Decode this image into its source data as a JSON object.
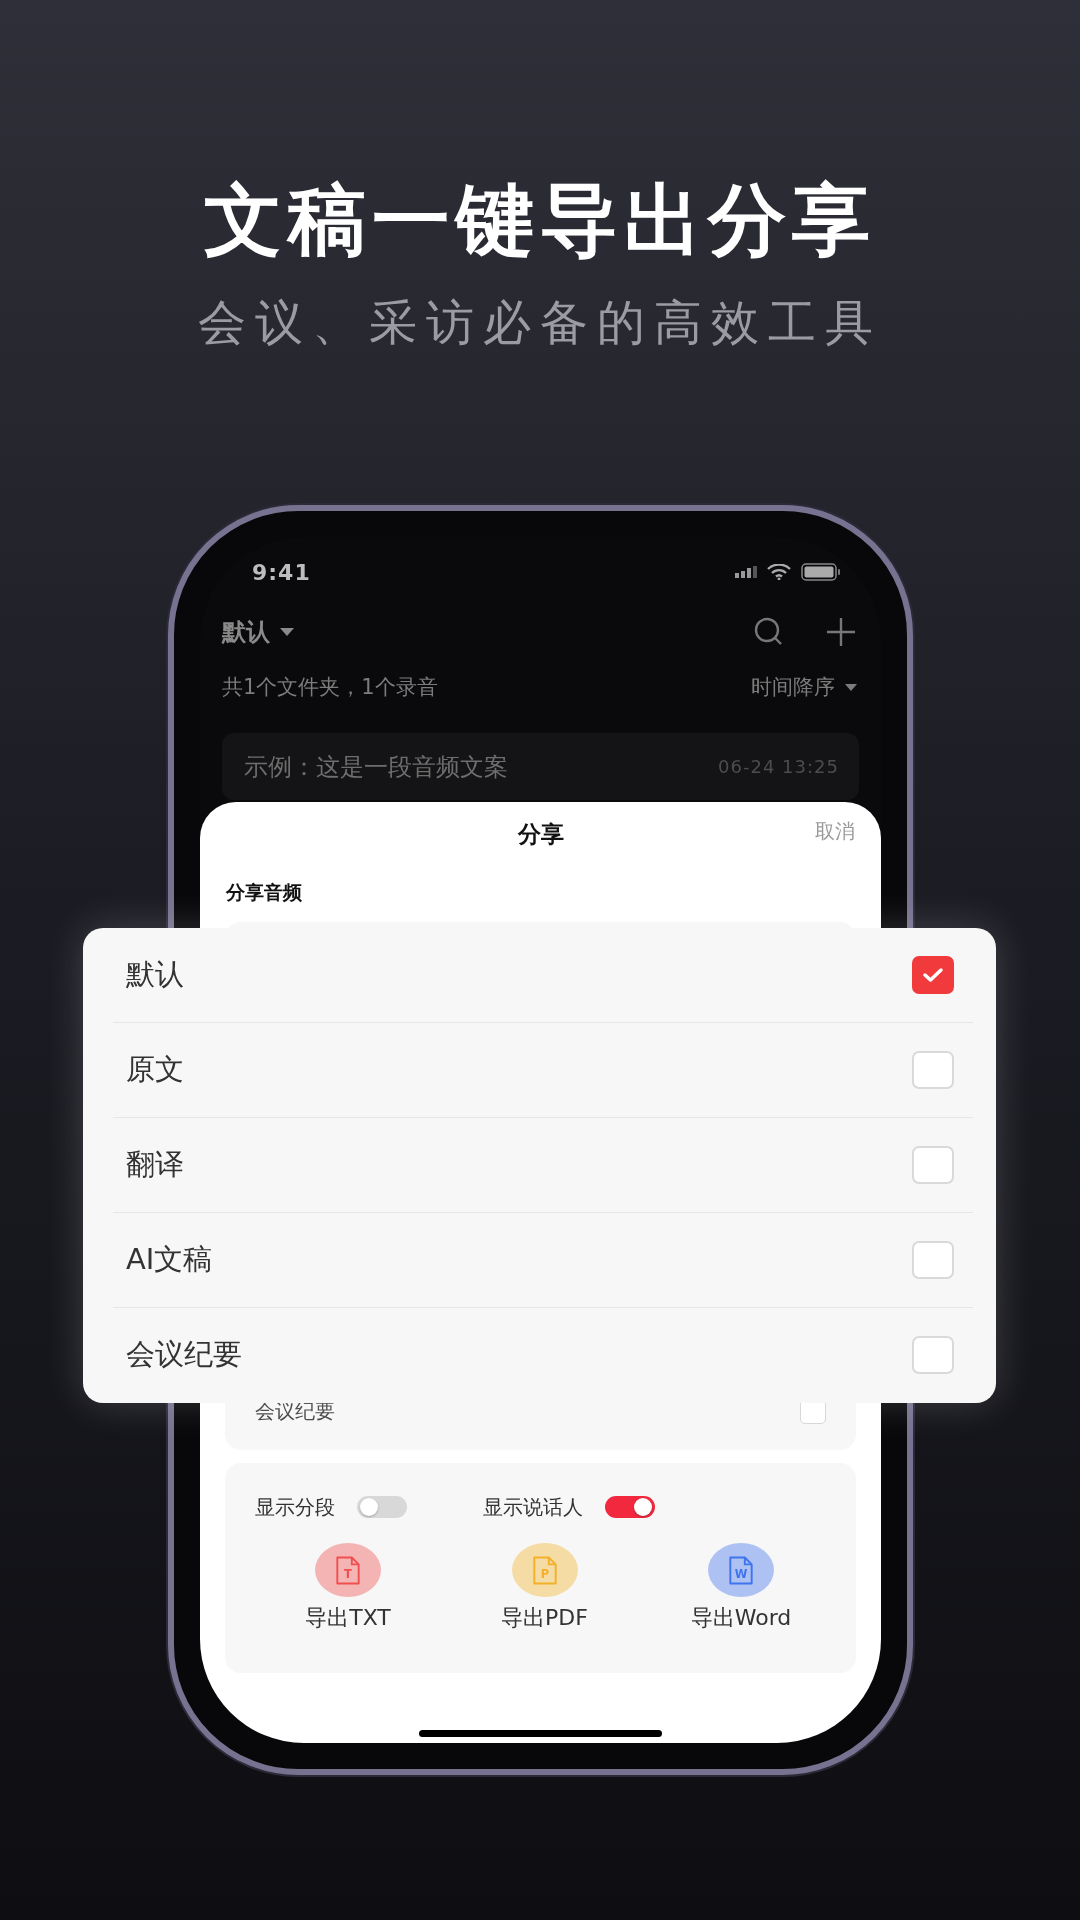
{
  "headline": "文稿一键导出分享",
  "subheadline": "会议、采访必备的高效工具",
  "status_bar": {
    "time": "9:41"
  },
  "header": {
    "folder": "默认"
  },
  "summary": "共1个文件夹，1个录音",
  "sort": "时间降序",
  "recordings": [
    {
      "title": "示例：这是一段音频文案",
      "time": "06-24 13:25"
    }
  ],
  "share_sheet": {
    "title": "分享",
    "cancel": "取消",
    "section": "分享音频",
    "options": [
      {
        "label": "会议纪要",
        "checked": false
      }
    ],
    "toggles": [
      {
        "label": "显示分段",
        "on": false
      },
      {
        "label": "显示说话人",
        "on": true
      }
    ],
    "exports": [
      {
        "label": "导出TXT",
        "icon_letter": "T",
        "color": "#f04f4f"
      },
      {
        "label": "导出PDF",
        "icon_letter": "P",
        "color": "#f2b128"
      },
      {
        "label": "导出Word",
        "icon_letter": "W",
        "color": "#3f74ee"
      }
    ]
  },
  "popup": {
    "options": [
      {
        "label": "默认",
        "checked": true
      },
      {
        "label": "原文",
        "checked": false
      },
      {
        "label": "翻译",
        "checked": false
      },
      {
        "label": "AI文稿",
        "checked": false
      },
      {
        "label": "会议纪要",
        "checked": false
      }
    ]
  }
}
